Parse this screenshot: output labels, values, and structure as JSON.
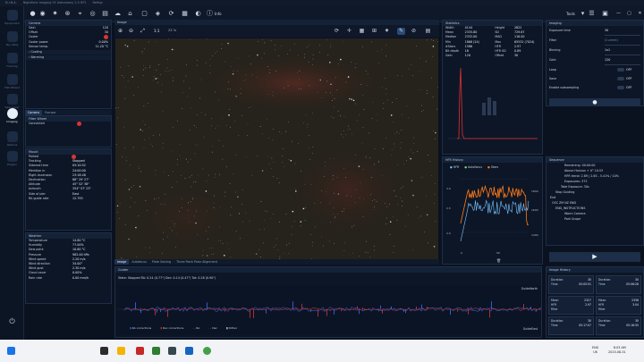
{
  "titlebar": {
    "app": "N.I.N.A.",
    "version": "Nighttime Imaging 'N' Astronomy 2.0 HF2",
    "profile": "Refrigr"
  },
  "nav": [
    {
      "label": "Equipment"
    },
    {
      "label": "Sky Atlas"
    },
    {
      "label": "Framing"
    },
    {
      "label": "Flat Wizard"
    },
    {
      "label": "Sequencer"
    },
    {
      "label": "Imaging"
    },
    {
      "label": "Options"
    },
    {
      "label": "Plugins"
    }
  ],
  "toolbar": {
    "info_label": "Info",
    "tools_label": "Tools"
  },
  "camera": {
    "title": "Camera",
    "rows": [
      {
        "k": "Gain",
        "v": "120"
      },
      {
        "k": "Offset",
        "v": "30"
      },
      {
        "k": "Cooler",
        "v": ""
      },
      {
        "k": "Cooler power",
        "v": "0.00%"
      },
      {
        "k": "Sensor temp.",
        "v": "11.20 °C"
      }
    ],
    "cooling_label": "Cooling",
    "warming_label": "Warming",
    "tabs": [
      "Camera",
      "Focuser"
    ]
  },
  "filterwheel": {
    "title": "Filter Wheel",
    "status": "Connected"
  },
  "mount": {
    "title": "Mount",
    "rows": [
      {
        "k": "Parked",
        "v": ""
      },
      {
        "k": "Tracking",
        "v": "Stopped"
      },
      {
        "k": "Sidereal time",
        "v": "05:10:52"
      },
      {
        "k": "Meridian in",
        "v": "24:00:00"
      },
      {
        "k": "Right Ascension",
        "v": "23:18:48"
      },
      {
        "k": "Declination",
        "v": "88° 29' 27\""
      },
      {
        "k": "Altitude",
        "v": "45° 52' 38\""
      },
      {
        "k": "Azimuth",
        "v": "354° 57' 23\""
      },
      {
        "k": "Side of pier",
        "v": "East"
      },
      {
        "k": "RA guide rate",
        "v": "12.793"
      }
    ]
  },
  "weather": {
    "title": "Weather",
    "rows": [
      {
        "k": "Temperature",
        "v": "14.80 °C"
      },
      {
        "k": "Humidity",
        "v": "77.00%"
      },
      {
        "k": "Dew point",
        "v": "10.80 °C"
      },
      {
        "k": "Pressure",
        "v": "982.00 hPa"
      },
      {
        "k": "Wind speed",
        "v": "2.20 m/s"
      },
      {
        "k": "Wind direction",
        "v": "34.00°"
      },
      {
        "k": "Wind gust",
        "v": "2.30 m/s"
      },
      {
        "k": "Cloud cover",
        "v": "0.00%"
      },
      {
        "k": "Rain rate",
        "v": "0.00 mm/h"
      }
    ]
  },
  "image": {
    "title": "Image",
    "zoom": "1:1",
    "zoom_pct": "23 %",
    "tabs": [
      "Image",
      "Autofocus",
      "Plate Solving",
      "Three Point Polar Alignment"
    ]
  },
  "statistics": {
    "title": "Statistics",
    "rows": [
      {
        "k": "Width",
        "v": "4144",
        "k2": "Height",
        "v2": "2822"
      },
      {
        "k": "Mean",
        "v": "2335.80",
        "k2": "SD",
        "v2": "729.67"
      },
      {
        "k": "Median",
        "v": "2332.00",
        "k2": "MAD",
        "v2": "116.00"
      },
      {
        "k": "Min",
        "v": "1868 (24)",
        "k2": "Max",
        "v2": "65532 (7024)"
      },
      {
        "k": "#Stars",
        "v": "1586",
        "k2": "HFR",
        "v2": "2.97"
      },
      {
        "k": "Bit depth",
        "v": "16",
        "k2": "HFR SD",
        "v2": "0.89"
      },
      {
        "k": "Gain",
        "v": "120",
        "k2": "Offset",
        "v2": "30"
      }
    ]
  },
  "hfr_history": {
    "title": "HFR History",
    "legend": [
      "HFR",
      "Autofocus",
      "Stars"
    ],
    "left_ticks": [
      "3.0",
      "2.5",
      "2.0"
    ],
    "right_ticks": [
      "1800",
      "1600",
      "1400"
    ],
    "x_ticks": [
      "0",
      "50"
    ]
  },
  "imaging": {
    "title": "Imaging",
    "rows": [
      {
        "k": "Exposure time",
        "v": "30"
      },
      {
        "k": "Filter",
        "v": "(Current)"
      },
      {
        "k": "Binning",
        "v": "1x1"
      },
      {
        "k": "Gain",
        "v": "120"
      }
    ],
    "toggles": [
      {
        "k": "Loop",
        "v": "OFF"
      },
      {
        "k": "Save",
        "v": "OFF"
      },
      {
        "k": "Enable subsampling",
        "v": "OFF"
      }
    ]
  },
  "sequence": {
    "title": "Sequence",
    "items": [
      "Remaining: 00:00:00",
      "Above Horizon + 0° 10:53",
      "HFR trend: 2.89 | 2.65 - 5.41% / 10%",
      "Exposures: 373",
      "Take Exposure: 30s",
      "Stop Guiding"
    ],
    "end_label": "End",
    "end_items": [
      "OSC ZM NZ END",
      "END_INSTRUCTIONS",
      "Warm Camera",
      "Park Scope"
    ]
  },
  "guider": {
    "title": "Guider",
    "state": "State: Stopped  RA: 0.24 (0.77\")  Dec: 0.14 (0.47\")  Tot: 0.28 (0.90\")",
    "north": "GuideNorth",
    "east": "GuideEast",
    "legend": [
      "RA corrections",
      "Dec corrections",
      "RA",
      "Dec",
      "Dither"
    ]
  },
  "image_history": {
    "title": "Image History",
    "cards": [
      {
        "rows": [
          [
            "Duration",
            "30"
          ],
          [
            "Time",
            "05:05:51"
          ]
        ]
      },
      {
        "rows": [
          [
            "Duration",
            "30"
          ],
          [
            "Time",
            "05:06:26"
          ]
        ]
      },
      {
        "rows": [
          [
            "Mean",
            "2327"
          ],
          [
            "HFR",
            "2.97"
          ],
          [
            "Filter",
            ""
          ]
        ]
      },
      {
        "rows": [
          [
            "Mean",
            "2336"
          ],
          [
            "HFR",
            "3.04"
          ],
          [
            "Filter",
            ""
          ]
        ]
      },
      {
        "rows": [
          [
            "Duration",
            "30"
          ],
          [
            "Time",
            "05:17:07"
          ]
        ]
      },
      {
        "rows": [
          [
            "Duration",
            "30"
          ],
          [
            "Time",
            "05:16:35"
          ]
        ]
      }
    ]
  },
  "taskbar": {
    "lang": "ENG",
    "lang2": "UK",
    "time": "8:03 AM",
    "date": "2023-08-31"
  },
  "colors": {
    "accent": "#e03131",
    "panel": "#0d1626",
    "hfr": "#79c3ff",
    "stars": "#ff7a1a",
    "autofocus": "#7cd67c"
  }
}
